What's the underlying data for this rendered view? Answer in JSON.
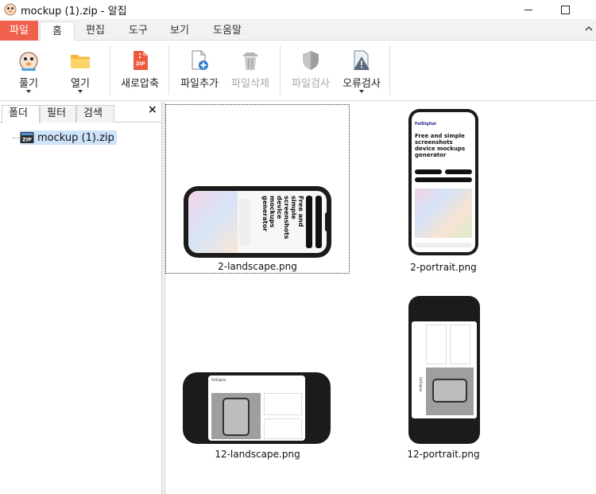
{
  "window": {
    "title": "mockup (1).zip - 알집",
    "app_icon": "alzip-mascot-icon",
    "minimize": "minimize-icon",
    "maximize": "maximize-icon"
  },
  "menu_tabs": [
    "파일",
    "홈",
    "편집",
    "도구",
    "보기",
    "도움말"
  ],
  "ribbon": {
    "extract": "풀기",
    "open": "열기",
    "new_archive": "새로압축",
    "add_file": "파일추가",
    "delete_file": "파일삭제",
    "scan_file": "파일검사",
    "error_check": "오류검사"
  },
  "left_panel": {
    "tabs": [
      "폴더",
      "필터",
      "검색"
    ],
    "close": "×",
    "tree_item": "mockup (1).zip",
    "zip_badge": "ZIP"
  },
  "files": [
    {
      "name": "2-landscape.png",
      "orientation": "landscape",
      "selected": true
    },
    {
      "name": "2-portrait.png",
      "orientation": "portrait",
      "selected": false
    },
    {
      "name": "12-landscape.png",
      "orientation": "landscape",
      "selected": false
    },
    {
      "name": "12-portrait.png",
      "orientation": "portrait",
      "selected": false
    }
  ],
  "thumbnail_text": {
    "headline": "Free and simple screenshots device mockups generator",
    "brand": "FalDigital",
    "nav": "MockuPhone"
  },
  "colors": {
    "file_tab": "#f0614d",
    "tree_selection": "#cde3f7"
  }
}
